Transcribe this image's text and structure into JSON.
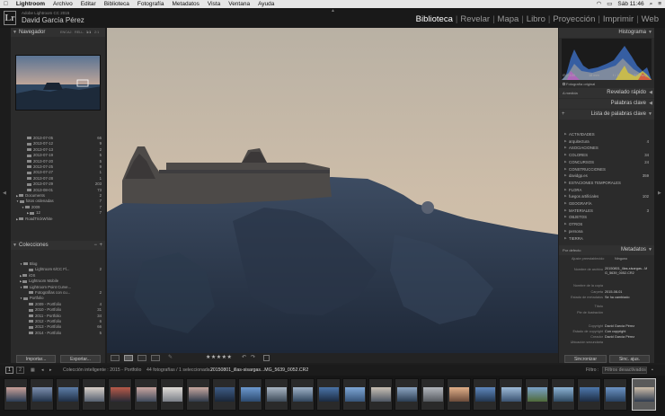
{
  "menubar": {
    "app": "Lightroom",
    "items": [
      "Archivo",
      "Editar",
      "Biblioteca",
      "Fotografía",
      "Metadatos",
      "Vista",
      "Ventana",
      "Ayuda"
    ],
    "clock": "Sáb 11:46"
  },
  "identity": {
    "product": "Adobe Lightroom CC 2015",
    "user": "David García Pérez"
  },
  "modules": [
    "Biblioteca",
    "Revelar",
    "Mapa",
    "Libro",
    "Proyección",
    "Imprimir",
    "Web"
  ],
  "navigator": {
    "title": "Navegador",
    "zoom_options": [
      "ENCAJ.",
      "RELL.",
      "1:1",
      "2:1"
    ]
  },
  "folders": [
    {
      "label": "2013-07-05",
      "count": "66"
    },
    {
      "label": "2013-07-12",
      "count": "9"
    },
    {
      "label": "2013-07-13",
      "count": "2"
    },
    {
      "label": "2013-07-19",
      "count": "5"
    },
    {
      "label": "2013-07-20",
      "count": "5"
    },
    {
      "label": "2013-07-25",
      "count": "9"
    },
    {
      "label": "2013-07-27",
      "count": "1"
    },
    {
      "label": "2013-07-28",
      "count": "1"
    },
    {
      "label": "2013-07-29",
      "count": "203"
    },
    {
      "label": "2013-08-01",
      "count": "73"
    },
    {
      "label": "Documents",
      "count": "2"
    },
    {
      "label": "fotos ordenadas",
      "count": "7"
    },
    {
      "label": "2009",
      "count": "7"
    },
    {
      "label": "12",
      "count": "7"
    },
    {
      "label": "RoadTrickWhite",
      "count": ""
    }
  ],
  "collections": {
    "title": "Colecciones",
    "items": [
      {
        "label": "Blog",
        "count": ""
      },
      {
        "label": "Lightroom 6/CC Fl...",
        "count": "2"
      },
      {
        "label": "iOS",
        "count": ""
      },
      {
        "label": "Lightroom Mobile",
        "count": ""
      },
      {
        "label": "Lightroom Point Curve...",
        "count": ""
      },
      {
        "label": "Fotografías con cu...",
        "count": "2"
      },
      {
        "label": "Portfolio",
        "count": ""
      },
      {
        "label": "2009 - Portfolio",
        "count": "4"
      },
      {
        "label": "2010 - Portfolio",
        "count": "31"
      },
      {
        "label": "2011 - Portfolio",
        "count": "34"
      },
      {
        "label": "2012 - Portfolio",
        "count": "6"
      },
      {
        "label": "2013 - Portfolio",
        "count": "66"
      },
      {
        "label": "2014 - Portfolio",
        "count": "5"
      }
    ]
  },
  "left_buttons": {
    "import": "Importar...",
    "export": "Exportar..."
  },
  "histogram": {
    "title": "Histograma",
    "readouts": [
      "ISO 100",
      "18 mm",
      "f / 11",
      "30.0 seg"
    ],
    "original_photo": "Fotografía original"
  },
  "quick_develop": {
    "preset": "A medida",
    "title": "Revelado rápido"
  },
  "keywords": {
    "title": "Palabras clave"
  },
  "keyword_list": {
    "title": "Lista de palabras clave",
    "items": [
      {
        "label": "ACTIVIDADES",
        "count": ""
      },
      {
        "label": "arquitectura",
        "count": "4"
      },
      {
        "label": "ASOCIACIONES",
        "count": ""
      },
      {
        "label": "COLORES",
        "count": "34"
      },
      {
        "label": "CONCURSOS",
        "count": "24"
      },
      {
        "label": "CONSTRUCCIONES",
        "count": ""
      },
      {
        "label": "davidgp.es",
        "count": "359"
      },
      {
        "label": "ESTACIONES TEMPORALES",
        "count": ""
      },
      {
        "label": "FLORA",
        "count": ""
      },
      {
        "label": "fuegos artificiales",
        "count": "102"
      },
      {
        "label": "GEOGRAFÍA",
        "count": ""
      },
      {
        "label": "MATERIALES",
        "count": "3"
      },
      {
        "label": "OBJETOS",
        "count": ""
      },
      {
        "label": "OTROS",
        "count": ""
      },
      {
        "label": "persona",
        "count": ""
      },
      {
        "label": "TIERRA",
        "count": ""
      }
    ]
  },
  "metadata": {
    "default_label": "Por defecto",
    "title": "Metadatos",
    "preset_label": "Ajuste preestablecido",
    "preset_value": "Ninguno",
    "rows": [
      {
        "label": "Nombre de archivo",
        "value": "20150801_illas-sisargas...MG_5639_0052.CR2"
      },
      {
        "label": "Nombre de la copia",
        "value": ""
      },
      {
        "label": "Carpeta",
        "value": "2015-08-01"
      },
      {
        "label": "Estado de metadatos",
        "value": "Se ha cambiado"
      },
      {
        "label": "Título",
        "value": ""
      },
      {
        "label": "Pie de ilustración",
        "value": ""
      },
      {
        "label": "Copyright",
        "value": "David García Pérez"
      },
      {
        "label": "Estado de copyright",
        "value": "Con copyright"
      },
      {
        "label": "Creador",
        "value": "David García Pérez"
      },
      {
        "label": "Ubicación secundaria",
        "value": ""
      }
    ]
  },
  "right_buttons": {
    "sync": "Sincronizar",
    "sync_settings": "Sinc. ajus."
  },
  "toolbar": {
    "rating": "★★★★★"
  },
  "filmstrip_bar": {
    "pages": [
      "1",
      "2"
    ],
    "source": "Colección inteligente : 2015 - Portfolio",
    "count": "44 fotografías / 1 seleccionada /",
    "file": "20150801_illas-sisargas...MG_5639_0052.CR2",
    "filter_label": "Filtro :",
    "filter_value": "Filtros desactivados"
  },
  "colors": {
    "accent": "#f0f0f0",
    "panel": "#2b2b2b",
    "bg": "#1e1e1e"
  }
}
